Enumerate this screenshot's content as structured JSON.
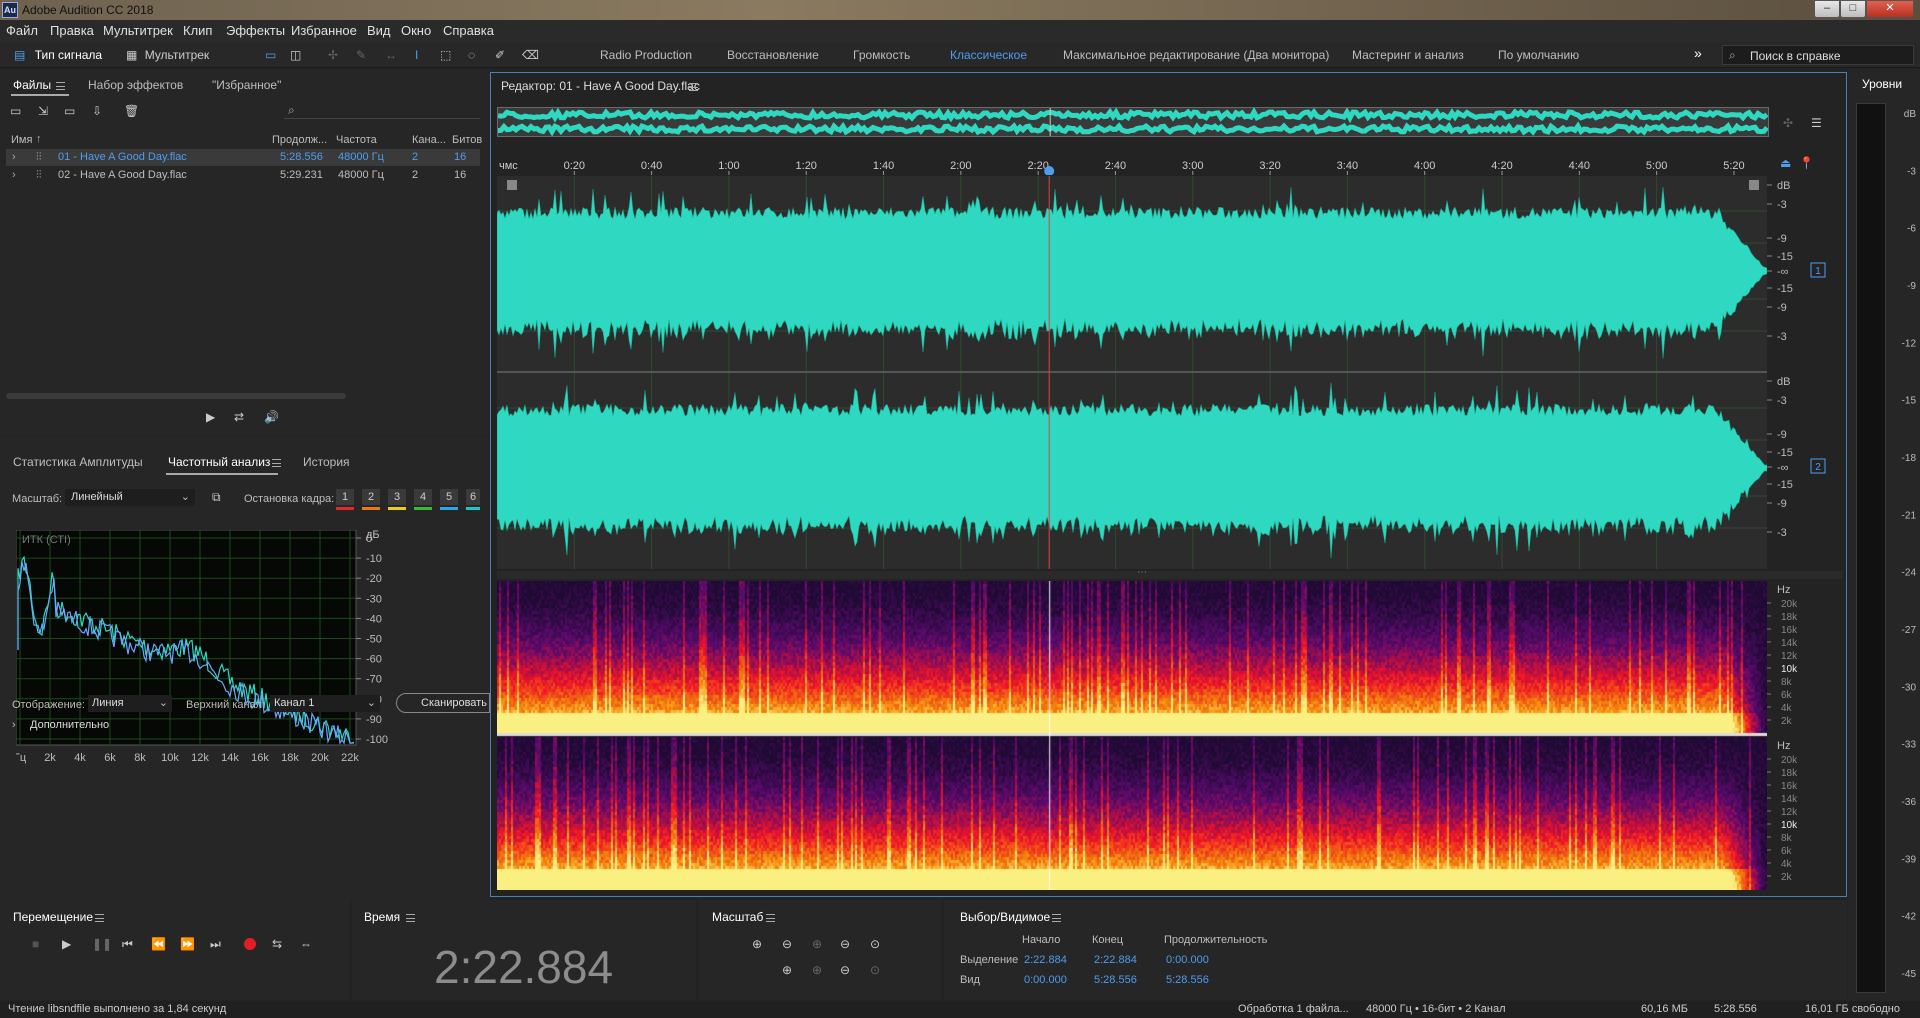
{
  "window": {
    "title": "Adobe Audition CC 2018",
    "logo": "Au",
    "btn_min": "–",
    "btn_max": "□",
    "btn_close": "✕"
  },
  "menu": [
    "Файл",
    "Правка",
    "Мультитрек",
    "Клип",
    "Эффекты",
    "Избранное",
    "Вид",
    "Окно",
    "Справка"
  ],
  "toolbar": {
    "waveform_label": "Тип сигнала",
    "multitrack_label": "Мультитрек",
    "workspaces": [
      "Radio Production",
      "Восстановление",
      "Громкость",
      "Классическое",
      "Максимальное редактирование (Два монитора)",
      "Мастеринг и анализ",
      "По умолчанию"
    ],
    "more": "»",
    "search_placeholder": "Поиск в справке"
  },
  "files": {
    "tabs": [
      "Файлы",
      "Набор эффектов",
      "\"Избранное\""
    ],
    "search_placeholder": "",
    "columns": [
      "Имя",
      "Продолж...",
      "Частота",
      "Кана...",
      "Битов"
    ],
    "rows": [
      {
        "name": "01 - Have A Good Day.flac",
        "duration": "5:28.556",
        "rate": "48000 Гц",
        "ch": "2",
        "bits": "16"
      },
      {
        "name": "02 - Have A Good Day.flac",
        "duration": "5:29.231",
        "rate": "48000 Гц",
        "ch": "2",
        "bits": "16"
      }
    ]
  },
  "analysis": {
    "tabs": [
      "Статистика Амплитуды",
      "Частотный анализ",
      "История"
    ],
    "scale_label": "Масштаб:",
    "scale_value": "Линейный",
    "freeze_label": "Остановка кадра:",
    "freeze_keys": [
      "1",
      "2",
      "3",
      "4",
      "5",
      "6"
    ],
    "freeze_colors": [
      "#e02a2a",
      "#e87a18",
      "#e8d010",
      "#3ab83a",
      "#28a8e0",
      "#18c8c8"
    ],
    "channel_label": "ИТК (СТI)",
    "db_unit": "дБ",
    "db_ticks": [
      "0",
      "-10",
      "-20",
      "-30",
      "-40",
      "-50",
      "-60",
      "-70",
      "-80",
      "-90",
      "-100"
    ],
    "hz_ticks": [
      "Гц",
      "2k",
      "4k",
      "6k",
      "8k",
      "10k",
      "12k",
      "14k",
      "16k",
      "18k",
      "20k",
      "22k"
    ],
    "display_label": "Отображение:",
    "display_value": "Линия",
    "top_channel_label": "Верхний канал:",
    "top_channel_value": "Канал 1",
    "scan_button": "Сканировать",
    "advanced": "Дополнительно"
  },
  "editor": {
    "title": "Редактор: 01 - Have A Good Day.flac",
    "timeline": [
      "чмс",
      "0:20",
      "0:40",
      "1:00",
      "1:20",
      "1:40",
      "2:00",
      "2:20",
      "2:40",
      "3:00",
      "3:20",
      "3:40",
      "4:00",
      "4:20",
      "4:40",
      "5:00",
      "5:20"
    ],
    "db_ticks": [
      "dB",
      "-3",
      "-9",
      "-15",
      "-∞",
      "-15",
      "-9",
      "-3"
    ],
    "hz_unit": "Hz",
    "hz_ticks": [
      "20k",
      "18k",
      "16k",
      "14k",
      "12k",
      "10k",
      "8k",
      "6k",
      "4k",
      "2k"
    ],
    "ch1": "1",
    "ch2": "2",
    "wave_color": "#2fd8c0",
    "playhead_fraction": 0.4348
  },
  "levels": {
    "title": "Уровни",
    "ticks": [
      "dB",
      "-3",
      "-6",
      "-9",
      "-12",
      "-15",
      "-18",
      "-21",
      "-24",
      "-27",
      "-30",
      "-33",
      "-36",
      "-39",
      "-42",
      "-45"
    ]
  },
  "transport": {
    "title": "Перемещение",
    "buttons": [
      "stop",
      "play",
      "pause",
      "go-start",
      "rewind",
      "fast-forward",
      "go-end",
      "record",
      "loop",
      "skip"
    ]
  },
  "time": {
    "title": "Время",
    "value": "2:22.884"
  },
  "zoom": {
    "title": "Масштаб"
  },
  "selection": {
    "title": "Выбор/Видимое",
    "headers": [
      "Начало",
      "Конец",
      "Продолжительность"
    ],
    "rows": [
      {
        "label": "Выделение",
        "start": "2:22.884",
        "end": "2:22.884",
        "duration": "0:00.000"
      },
      {
        "label": "Вид",
        "start": "0:00.000",
        "end": "5:28.556",
        "duration": "5:28.556"
      }
    ]
  },
  "status": {
    "left": "Чтение libsndfile выполнено за 1,84 секунд",
    "processing": "Обработка 1 файла...",
    "format": "48000 Гц • 16-бит • 2 Канал",
    "size": "60,16 МБ",
    "duration": "5:28.556",
    "free": "16,01 ГБ свободно"
  }
}
